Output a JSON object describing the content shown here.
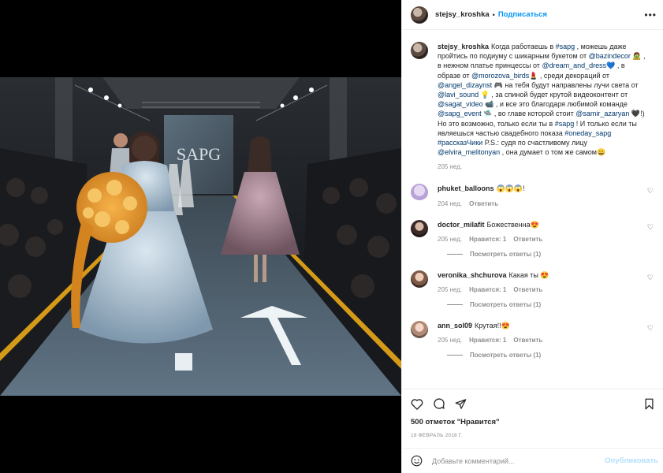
{
  "header": {
    "username": "stejsy_kroshka",
    "separator": "•",
    "follow_label": "Подписаться",
    "more_label": "•••"
  },
  "caption": {
    "username": "stejsy_kroshka",
    "parts": [
      "Когда работаешь в ",
      "#sapg",
      " , можешь даже пройтись по подиуму с шикарным букетом от ",
      "@bazindecor",
      " 🧟 , в нежном платье принцессы от ",
      "@dream_and_dress",
      "💙 , в образе от ",
      "@morozova_birds",
      "💄 , среди декораций от ",
      "@angel_dizaynst",
      " 🎮 на тебя будут направлены лучи света от ",
      "@lavi_sound",
      " 💡 , за спиной будет крутой видеоконтент от ",
      "@sagat_video",
      " 📹 , и все это благодаря любимой команде ",
      "@sapg_event",
      " 🛸 , во главе которой стоит ",
      "@samir_azaryan",
      " 🖤!) Но это возможно, только если ты в ",
      "#sapg",
      " ! И только если ты являешься частью свадебного показа ",
      "#oneday_sapg",
      " ",
      "#рассказЧики",
      " P.S.: судя по счастливому лицу ",
      "@elvira_melitonyan",
      " , она думает о том же самом😀"
    ],
    "time": "205 нед."
  },
  "comments": [
    {
      "username": "phuket_balloons",
      "text": "😱😱😱!",
      "time": "204 нед.",
      "likes": "",
      "reply": "Ответить",
      "view_replies": ""
    },
    {
      "username": "doctor_milafit",
      "text": "Божественна😍",
      "time": "205 нед.",
      "likes": "Нравится: 1",
      "reply": "Ответить",
      "view_replies": "Посмотреть ответы (1)"
    },
    {
      "username": "veronika_shchurova",
      "text": "Какая ты 😍",
      "time": "205 нед.",
      "likes": "Нравится: 1",
      "reply": "Ответить",
      "view_replies": "Посмотреть ответы (1)"
    },
    {
      "username": "ann_sol09",
      "text": "Крутая!!😍",
      "time": "205 нед.",
      "likes": "Нравится: 1",
      "reply": "Ответить",
      "view_replies": "Посмотреть ответы (1)"
    }
  ],
  "actions": {
    "likes": "500 отметок \"Нравится\"",
    "date": "18 ФЕВРАЛЬ 2018 Г."
  },
  "add_comment": {
    "placeholder": "Добавьте комментарий...",
    "publish_label": "Опубликовать"
  },
  "photo": {
    "stage_sign": "SAPG"
  },
  "icons": {
    "heart": "heart-icon",
    "comment": "comment-icon",
    "share": "share-icon",
    "save": "bookmark-icon",
    "emoji": "emoji-icon"
  }
}
